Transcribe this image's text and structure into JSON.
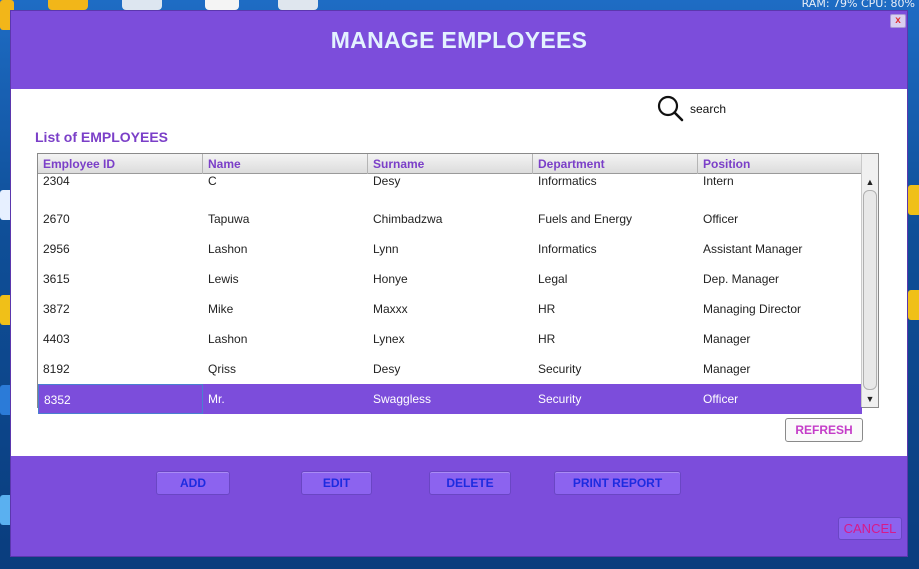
{
  "system": {
    "monitor_text": "RAM: 79%  CPU: 80%"
  },
  "window": {
    "title": "MANAGE EMPLOYEES",
    "close_label": "x"
  },
  "search": {
    "icon": "search-icon",
    "label": "search"
  },
  "list": {
    "title": "List of EMPLOYEES"
  },
  "table": {
    "columns": [
      "Employee ID",
      "Name",
      "Surname",
      "Department",
      "Position"
    ],
    "rows": [
      {
        "id": "2304",
        "name": "C",
        "surname": "Desy",
        "department": "Informatics",
        "position": "Intern"
      },
      {
        "id": "2670",
        "name": "Tapuwa",
        "surname": "Chimbadzwa",
        "department": "Fuels and Energy",
        "position": "Officer"
      },
      {
        "id": "2956",
        "name": "Lashon",
        "surname": "Lynn",
        "department": "Informatics",
        "position": "Assistant Manager"
      },
      {
        "id": "3615",
        "name": "Lewis",
        "surname": "Honye",
        "department": "Legal",
        "position": "Dep. Manager"
      },
      {
        "id": "3872",
        "name": "Mike",
        "surname": "Maxxx",
        "department": "HR",
        "position": "Managing Director"
      },
      {
        "id": "4403",
        "name": "Lashon",
        "surname": "Lynex",
        "department": "HR",
        "position": "Manager"
      },
      {
        "id": "8192",
        "name": "Qriss",
        "surname": "Desy",
        "department": "Security",
        "position": "Manager"
      },
      {
        "id": "8352",
        "name": "Mr.",
        "surname": "Swaggless",
        "department": "Security",
        "position": "Officer"
      }
    ],
    "selected_index": 7
  },
  "buttons": {
    "refresh": "REFRESH",
    "add": "ADD",
    "edit": "EDIT",
    "delete": "DELETE",
    "print_report": "PRINT REPORT",
    "cancel": "CANCEL"
  },
  "colors": {
    "window_purple": "#7c4ddb",
    "title_text": "#e3f2ff",
    "header_text": "#7b3fc8",
    "button_text": "#1d2be0",
    "cancel_text": "#d61a8a",
    "refresh_text": "#c43cc8"
  }
}
